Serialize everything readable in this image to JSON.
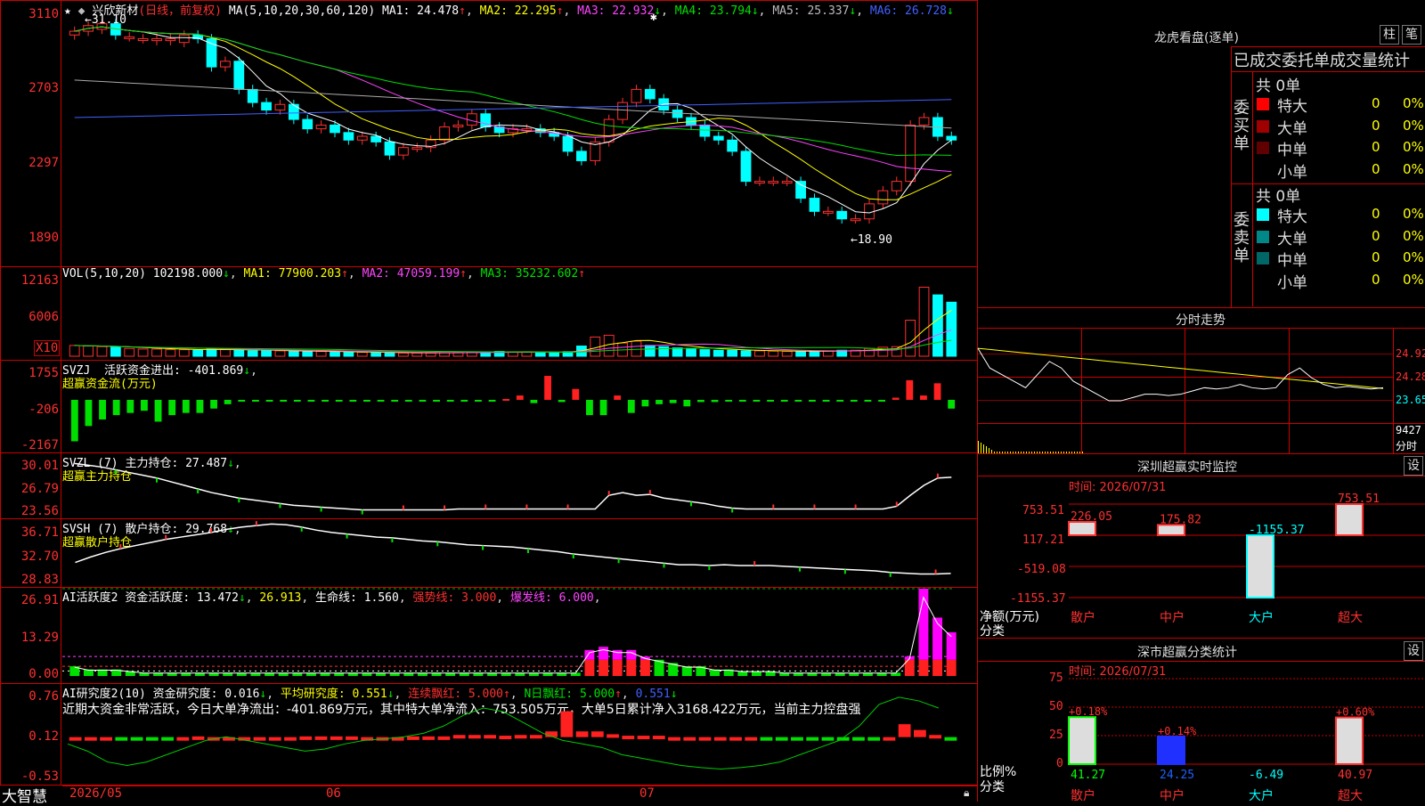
{
  "stock": {
    "name": "兴欣新材",
    "mode": "(日线，前复权)"
  },
  "price_pane": {
    "ma_label": "MA(5,10,20,30,60,120)",
    "ma1": "MA1: 24.478",
    "ma1_arrow": "↑",
    "ma2": "MA2: 22.295",
    "ma2_arrow": "↑",
    "ma3": "MA3: 22.932",
    "ma3_arrow": "↓",
    "ma4": "MA4: 23.794",
    "ma4_arrow": "↓",
    "ma5": "MA5: 25.337",
    "ma5_arrow": "↓",
    "ma6": "MA6: 26.728",
    "ma6_arrow": "↓",
    "axis": [
      "3110",
      "2703",
      "2297",
      "1890"
    ],
    "high_mark": "31.10",
    "low_mark": "18.90"
  },
  "vol_pane": {
    "label": "VOL(5,10,20)",
    "vol": "102198.000",
    "vol_arrow": "↓",
    "ma1": "MA1: 77900.203",
    "ma1_arrow": "↑",
    "ma2": "MA2: 47059.199",
    "ma2_arrow": "↑",
    "ma3": "MA3: 35232.602",
    "ma3_arrow": "↑",
    "axis": [
      "12163",
      "6006"
    ],
    "x10": "X10"
  },
  "svzj_pane": {
    "label": "SVZJ",
    "text": "活跃资金进出: -401.869",
    "arrow": "↓",
    "sub": "超赢资金流(万元)",
    "axis": [
      "1755",
      "-206",
      "-2167"
    ]
  },
  "svzl_pane": {
    "label": "SVZL (7)",
    "text": "主力持仓: 27.487",
    "arrow": "↓",
    "sub": "超赢主力持仓",
    "axis": [
      "30.01",
      "26.79",
      "23.56"
    ]
  },
  "svsh_pane": {
    "label": "SVSH (7)",
    "text": "散户持仓: 29.768",
    "arrow": "↓",
    "sub": "超赢散户持仓",
    "axis": [
      "36.71",
      "32.70",
      "28.83"
    ]
  },
  "ai_act_pane": {
    "label": "AI活跃度2",
    "text1": "资金活跃度: 13.472",
    "arrow1": "↓",
    "text2": "26.913",
    "text3": "生命线: 1.560",
    "text4": "强势线: 3.000",
    "text5": "爆发线: 6.000",
    "axis": [
      "26.91",
      "13.29",
      "0.00"
    ]
  },
  "ai_res_pane": {
    "label": "AI研究度2(10)",
    "text1": "资金研究度: 0.016",
    "arrow1": "↓",
    "text2": "平均研究度: 0.551",
    "arrow2": "↓",
    "text3": "连续飘红: 5.000",
    "arrow3": "↑",
    "text4": "N日飘红: 5.000",
    "arrow4": "↑",
    "text5": "0.551",
    "arrow5": "↓",
    "comment": "近期大资金非常活跃，今日大单净流出：-401.869万元，其中特大单净流入：753.505万元，大单5日累计净入3168.422万元，当前主力控盘强",
    "axis": [
      "0.76",
      "0.12",
      "-0.53"
    ]
  },
  "footer": {
    "brand": "大智慧",
    "dates": [
      "2026/05",
      "06",
      "07"
    ]
  },
  "dragon_tiger": {
    "title": "龙虎看盘(逐单)",
    "btn1": "柱",
    "btn2": "笔",
    "header": "已成交委托单成交量统计",
    "buy_side": "委买单",
    "sell_side": "委卖单",
    "count": "共 0单",
    "buy_rows": [
      {
        "label": "特大",
        "value": "0",
        "pct": "0%",
        "color": "#ff0000"
      },
      {
        "label": "大单",
        "value": "0",
        "pct": "0%",
        "color": "#a00000"
      },
      {
        "label": "中单",
        "value": "0",
        "pct": "0%",
        "color": "#600000"
      },
      {
        "label": "小单",
        "value": "0",
        "pct": "0%",
        "color": "#000000"
      }
    ],
    "sell_rows": [
      {
        "label": "特大",
        "value": "0",
        "pct": "0%",
        "color": "#00ffff"
      },
      {
        "label": "大单",
        "value": "0",
        "pct": "0%",
        "color": "#008888"
      },
      {
        "label": "中单",
        "value": "0",
        "pct": "0%",
        "color": "#006666"
      },
      {
        "label": "小单",
        "value": "0",
        "pct": "0%",
        "color": "#000000"
      }
    ]
  },
  "intraday": {
    "title": "分时走势",
    "axis": [
      "24.92",
      "24.28",
      "23.65"
    ],
    "vol": "9427",
    "vol_label": "分时"
  },
  "monitor": {
    "title": "深圳超赢实时监控",
    "btn": "设",
    "time": "时间: 2026/07/31",
    "axis": [
      "753.51",
      "117.21",
      "-519.08",
      "-1155.37"
    ],
    "side": "净额(万元)",
    "side2": "分类",
    "cats": [
      "散户",
      "中户",
      "大户",
      "超大"
    ],
    "bar_labels": [
      "226.05",
      "175.82",
      "-1155.37",
      "753.51"
    ]
  },
  "classify": {
    "title": "深市超赢分类统计",
    "btn": "设",
    "time": "时间: 2026/07/31",
    "axis": [
      "75",
      "50",
      "25",
      "0"
    ],
    "side": "比例%",
    "side2": "分类",
    "cats": [
      "散户",
      "中户",
      "大户",
      "超大"
    ],
    "pct_labels": [
      "+0.18%",
      "+0.14%",
      "+0.60%"
    ],
    "bottom_values": [
      "41.27",
      "24.25",
      "-6.49",
      "40.97"
    ]
  },
  "chart_data": [
    {
      "type": "candlestick",
      "title": "兴欣新材 (日线，前复权)",
      "ylim": [
        18.5,
        31.6
      ],
      "open": [
        30.4,
        30.6,
        30.7,
        31.0,
        30.3,
        30.2,
        30.1,
        30.1,
        30.0,
        30.4,
        30.2,
        28.7,
        29.0,
        27.5,
        26.8,
        26.4,
        26.7,
        25.9,
        25.4,
        25.6,
        25.2,
        24.8,
        25.0,
        24.7,
        24.0,
        24.4,
        24.4,
        24.8,
        25.5,
        25.6,
        26.2,
        25.5,
        25.2,
        25.4,
        25.4,
        25.2,
        25.0,
        24.2,
        23.7,
        24.7,
        25.9,
        26.8,
        27.5,
        27.0,
        26.4,
        26.0,
        25.6,
        25.0,
        24.8,
        24.2,
        22.6,
        22.6,
        22.6,
        22.6,
        21.7,
        21.0,
        21.0,
        20.6,
        20.6,
        21.4,
        22.1,
        22.6,
        25.6,
        26.0,
        25.0
      ],
      "close": [
        30.6,
        30.9,
        31.0,
        30.4,
        30.3,
        30.2,
        30.2,
        30.2,
        30.4,
        30.2,
        28.7,
        29.0,
        27.5,
        26.8,
        26.4,
        26.7,
        25.9,
        25.4,
        25.6,
        25.2,
        24.8,
        25.0,
        24.7,
        24.0,
        24.4,
        24.4,
        24.8,
        25.5,
        25.6,
        26.2,
        25.5,
        25.2,
        25.4,
        25.4,
        25.2,
        25.0,
        24.2,
        23.7,
        24.7,
        25.9,
        26.8,
        27.5,
        27.0,
        26.4,
        26.0,
        25.6,
        25.0,
        24.8,
        24.2,
        22.6,
        22.6,
        22.6,
        22.6,
        21.7,
        21.0,
        21.0,
        20.6,
        20.6,
        21.4,
        22.1,
        22.6,
        25.6,
        26.0,
        25.0,
        24.8
      ],
      "ma5_last": 24.478,
      "ma10_last": 22.295,
      "ma20_last": 22.932,
      "ma30_last": 23.794,
      "ma60_last": 25.337,
      "ma120_last": 26.728,
      "max": 31.1,
      "min": 18.9
    },
    {
      "type": "bar",
      "title": "VOL(5,10,20)",
      "ylim": [
        0,
        12163
      ],
      "values": [
        1800,
        1700,
        1600,
        1500,
        1300,
        1200,
        1200,
        1100,
        1100,
        1000,
        1300,
        1100,
        1000,
        900,
        900,
        900,
        850,
        800,
        800,
        700,
        650,
        650,
        600,
        600,
        550,
        550,
        550,
        600,
        650,
        700,
        700,
        800,
        700,
        700,
        650,
        650,
        750,
        1700,
        3200,
        3500,
        2200,
        2500,
        1800,
        1600,
        1400,
        1300,
        1100,
        1000,
        1000,
        900,
        900,
        850,
        800,
        800,
        850,
        900,
        1000,
        1000,
        1300,
        1500,
        1600,
        6000,
        11500,
        10219,
        9000
      ],
      "ma1_last": 77900.203,
      "ma2_last": 47059.199,
      "ma3_last": 35232.602
    },
    {
      "type": "bar",
      "title": "SVZJ 活跃资金进出",
      "ylim": [
        -2167,
        1755
      ],
      "unit": "万元",
      "values": [
        -1900,
        -1200,
        -900,
        -700,
        -600,
        -500,
        -1000,
        -700,
        -600,
        -600,
        -400,
        -200,
        -80,
        -80,
        -80,
        -60,
        -60,
        -60,
        -40,
        -40,
        -30,
        -30,
        -30,
        -30,
        -60,
        -60,
        -60,
        -50,
        -40,
        -20,
        -10,
        40,
        200,
        -150,
        1100,
        -100,
        500,
        -700,
        -700,
        200,
        -600,
        -300,
        -200,
        -150,
        -300,
        -100,
        -100,
        -80,
        -80,
        -60,
        -60,
        -50,
        -50,
        -50,
        -40,
        -30,
        -30,
        -20,
        -20,
        100,
        900,
        200,
        760,
        -401.869
      ],
      "last": -401.869
    },
    {
      "type": "line",
      "title": "SVZL (7) 主力持仓",
      "ylim": [
        23.56,
        30.01
      ],
      "values": [
        29.0,
        28.8,
        28.6,
        28.3,
        28.0,
        27.7,
        27.4,
        27.0,
        26.6,
        26.2,
        25.8,
        25.5,
        25.2,
        25.0,
        24.8,
        24.6,
        24.4,
        24.3,
        24.2,
        24.1,
        24.0,
        23.9,
        23.9,
        23.9,
        23.9,
        23.9,
        23.9,
        23.9,
        24.0,
        24.0,
        24.0,
        24.0,
        24.0,
        24.0,
        24.0,
        24.0,
        24.0,
        24.0,
        24.0,
        25.5,
        25.8,
        25.5,
        25.6,
        25.2,
        25.0,
        24.8,
        24.6,
        24.3,
        24.1,
        24.0,
        24.0,
        24.0,
        24.0,
        24.0,
        24.0,
        24.0,
        24.0,
        24.0,
        24.0,
        24.0,
        24.3,
        25.5,
        26.6,
        27.4,
        27.487
      ],
      "last": 27.487
    },
    {
      "type": "line",
      "title": "SVSH (7) 散户持仓",
      "ylim": [
        28.83,
        36.71
      ],
      "values": [
        31.2,
        31.9,
        32.5,
        33.0,
        33.4,
        33.8,
        34.2,
        34.5,
        34.8,
        35.1,
        35.5,
        35.8,
        36.0,
        36.2,
        36.1,
        35.8,
        35.4,
        35.1,
        34.9,
        34.7,
        34.5,
        34.4,
        34.2,
        34.0,
        33.9,
        33.7,
        33.5,
        33.4,
        33.3,
        33.2,
        33.0,
        32.8,
        32.6,
        32.3,
        32.1,
        31.9,
        31.7,
        31.5,
        31.3,
        31.1,
        30.9,
        30.9,
        30.8,
        30.9,
        30.8,
        30.8,
        30.8,
        30.7,
        30.6,
        30.5,
        30.4,
        30.3,
        30.2,
        30.1,
        29.9,
        29.8,
        29.7,
        29.7,
        29.768
      ],
      "last": 29.768
    },
    {
      "type": "bar",
      "title": "AI活跃度2 资金活跃度",
      "ylim": [
        0,
        26.91
      ],
      "values": [
        3,
        2,
        2,
        2,
        1.5,
        1,
        1,
        1,
        1,
        1,
        1,
        1,
        1,
        1,
        1,
        1,
        1,
        1,
        1,
        1,
        1,
        1,
        1,
        1,
        1,
        1,
        1,
        1,
        1,
        1,
        1,
        1,
        1,
        1,
        1,
        1,
        1,
        8,
        9,
        8,
        8,
        6,
        5,
        4,
        3,
        3,
        2,
        2,
        1.5,
        1.5,
        1.5,
        1,
        1,
        1,
        1,
        1,
        1,
        1,
        1,
        1,
        6,
        26.91,
        18,
        13.472
      ],
      "last": 13.472,
      "life_line": 1.56,
      "strong_line": 3.0,
      "burst_line": 6.0
    },
    {
      "type": "bar",
      "title": "AI研究度2(10) 资金研究度",
      "ylim": [
        -0.53,
        0.76
      ],
      "values": [
        0.02,
        0.02,
        0.02,
        0.01,
        0.01,
        0.01,
        0.01,
        0.02,
        0.03,
        0.02,
        0.02,
        0.02,
        0.02,
        0.02,
        0.02,
        0.03,
        0.03,
        0.03,
        0.03,
        0.02,
        0.02,
        0.02,
        0.03,
        0.03,
        0.03,
        0.05,
        0.05,
        0.05,
        0.04,
        0.05,
        0.05,
        0.1,
        0.38,
        0.1,
        0.1,
        0.06,
        0.04,
        0.04,
        0.04,
        0.02,
        0.02,
        0.02,
        0.02,
        0.02,
        0.02,
        -0.02,
        -0.02,
        -0.02,
        -0.02,
        -0.02,
        -0.02,
        -0.02,
        -0.02,
        0.02,
        0.2,
        0.12,
        0.05,
        0.016
      ],
      "last": 0.016,
      "avg": 0.551
    },
    {
      "type": "bar",
      "title": "深圳超赢实时监控",
      "ylim": [
        -1155.37,
        753.51
      ],
      "unit": "万元",
      "categories": [
        "散户",
        "中户",
        "大户",
        "超大"
      ],
      "values": [
        226.05,
        175.82,
        -1155.37,
        753.51
      ]
    },
    {
      "type": "bar",
      "title": "深市超赢分类统计",
      "ylim": [
        0,
        75
      ],
      "unit": "%",
      "categories": [
        "散户",
        "中户",
        "大户",
        "超大"
      ],
      "values": [
        41.27,
        24.25,
        -6.49,
        40.97
      ],
      "changes": [
        "+0.18%",
        "+0.14%",
        "",
        "+0.60%"
      ]
    }
  ]
}
